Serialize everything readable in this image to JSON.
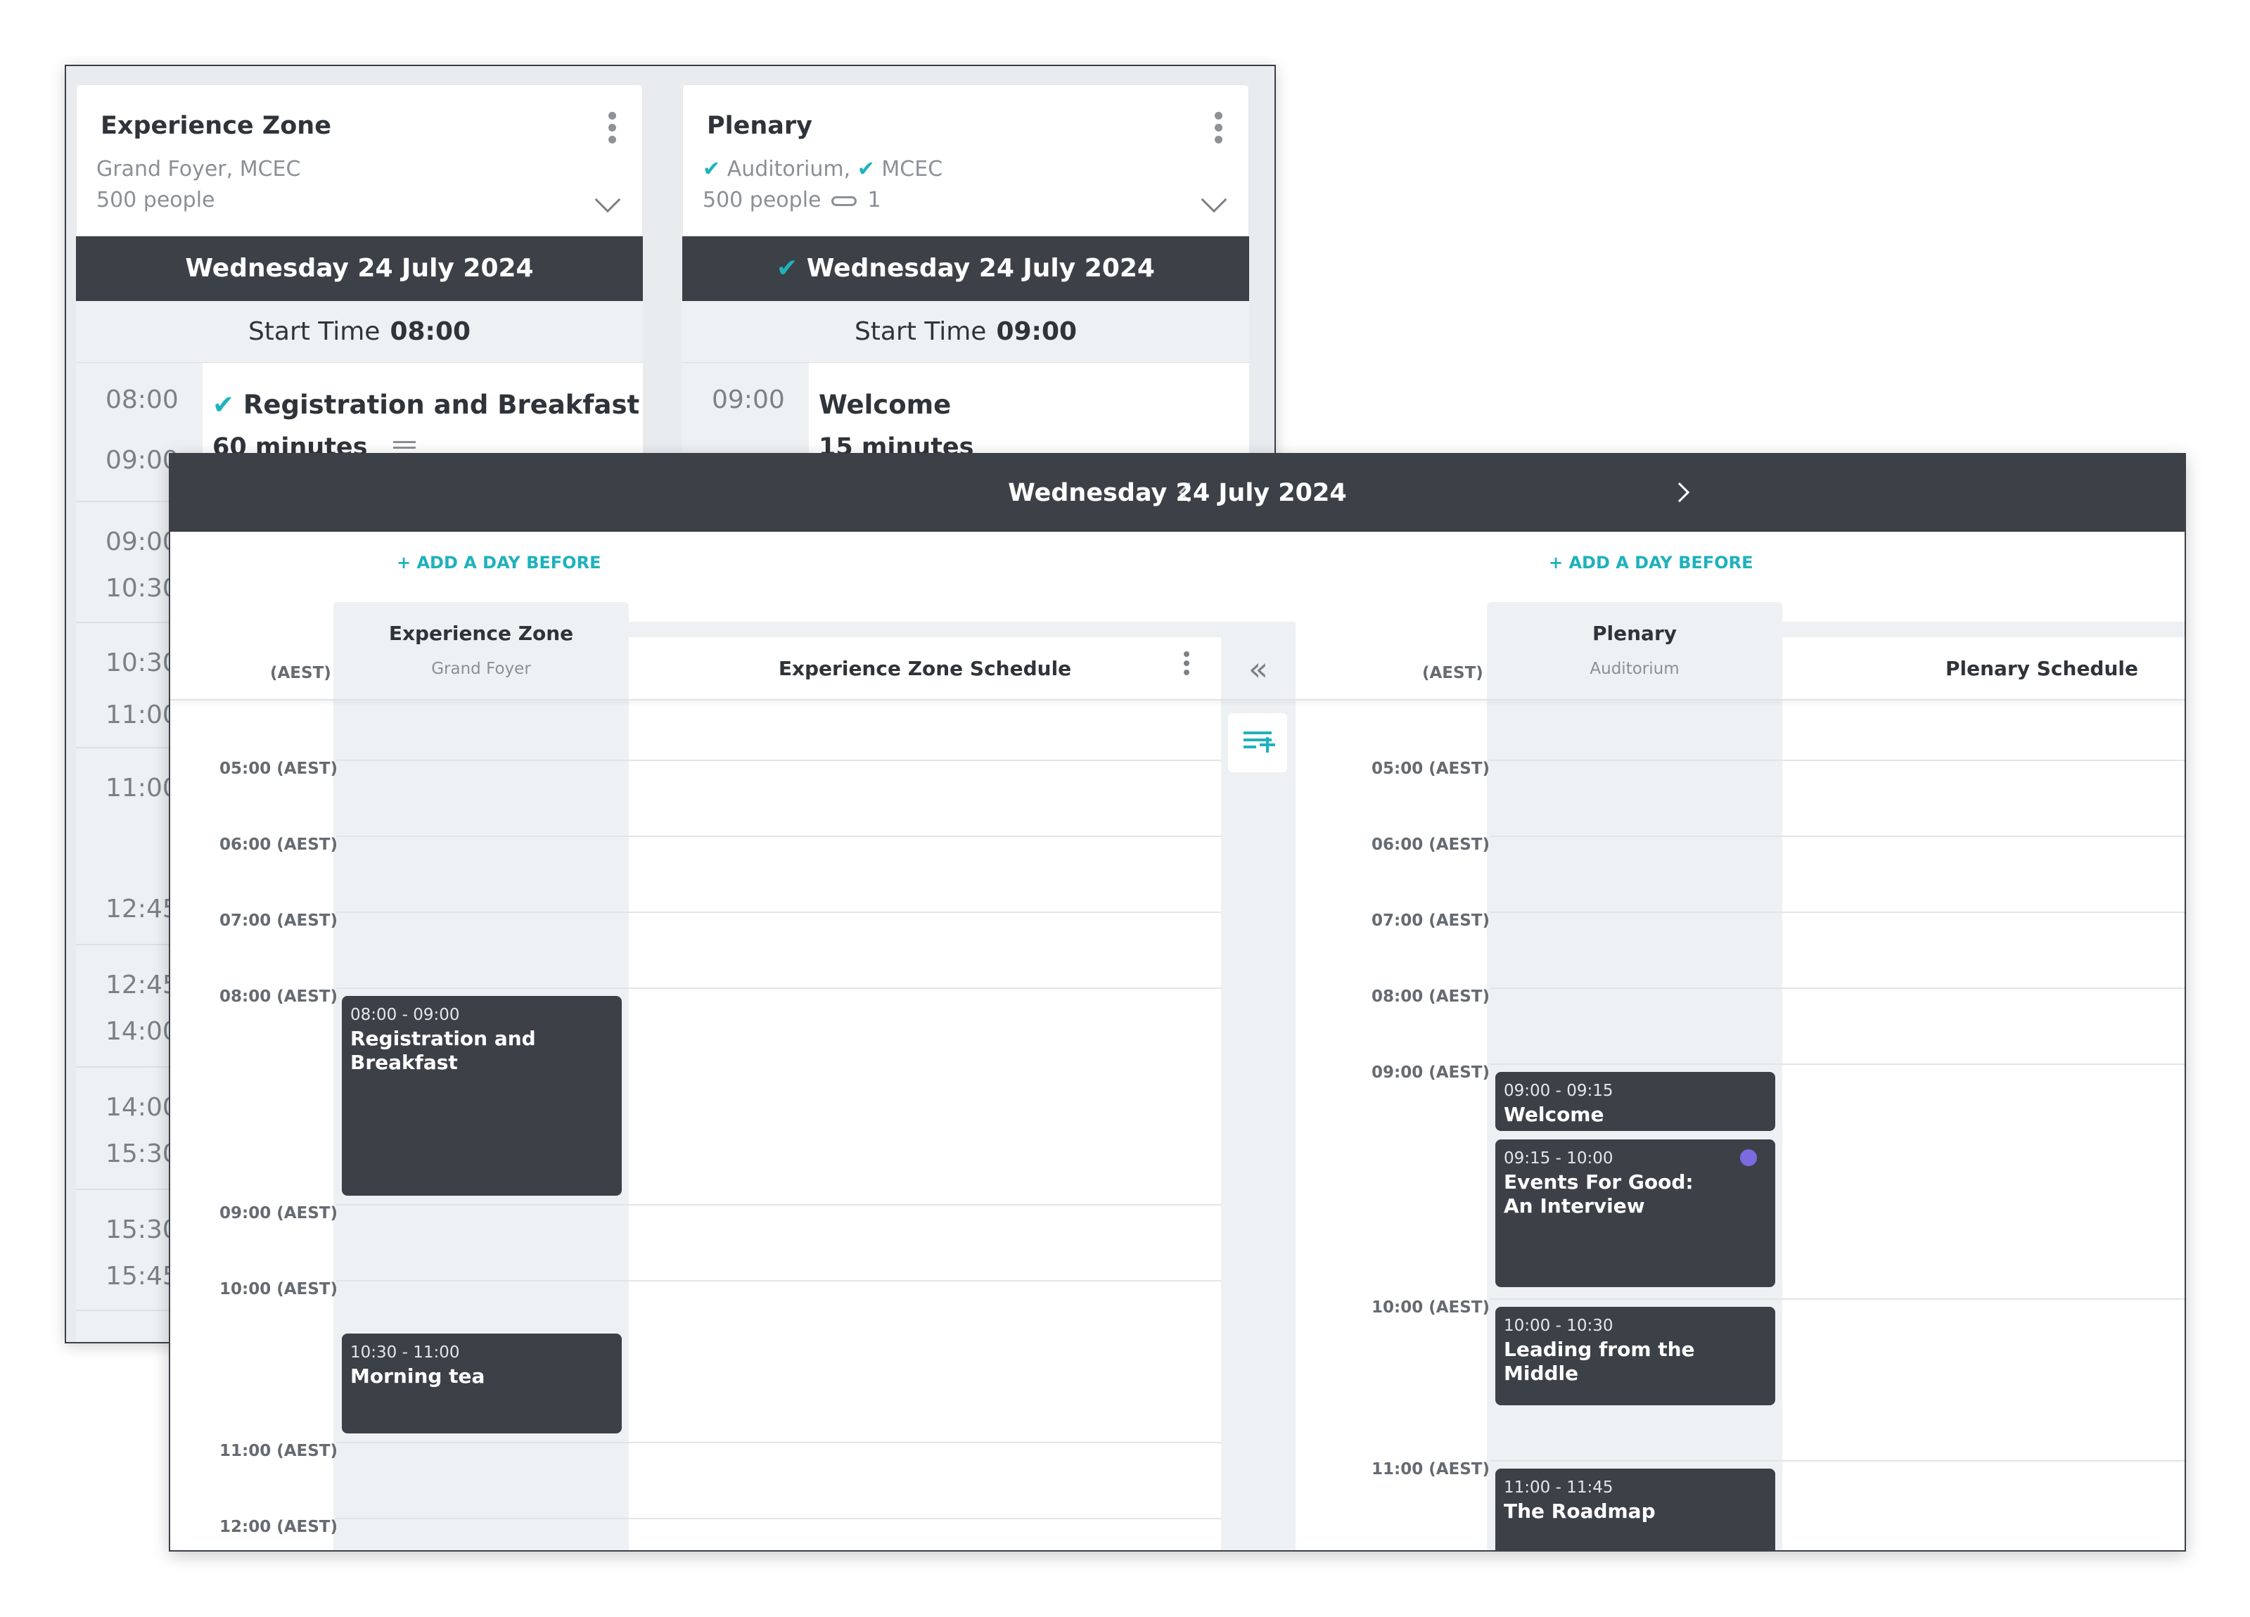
{
  "back_window": {
    "rooms": [
      {
        "title": "Experience Zone",
        "location": "Grand Foyer, MCEC",
        "capacity": "500 people",
        "date": "Wednesday 24 July 2024",
        "start_label": "Start Time",
        "start_time": "08:00",
        "first_item": {
          "time": "08:00",
          "end": "09:00",
          "title": "Registration and Breakfast",
          "duration": "60 minutes"
        },
        "times": [
          "09:00",
          "10:30",
          "10:30",
          "11:00",
          "11:00",
          "12:45",
          "12:45",
          "14:00",
          "14:00",
          "15:30",
          "15:30",
          "15:45"
        ]
      },
      {
        "title": "Plenary",
        "location_part1": "Auditorium,",
        "location_part2": "MCEC",
        "capacity": "500 people",
        "attachments": "1",
        "date": "Wednesday 24 July 2024",
        "start_label": "Start Time",
        "start_time": "09:00",
        "first_item": {
          "time": "09:00",
          "title": "Welcome",
          "duration": "15 minutes"
        }
      }
    ]
  },
  "front_window": {
    "date": "Wednesday 24 July 2024",
    "add_day_before": "+ ADD A DAY BEFORE",
    "tz_label": "(AEST)",
    "left": {
      "room": "Experience Zone",
      "location": "Grand Foyer",
      "schedule_title": "Experience Zone Schedule",
      "hours": [
        "05:00 (AEST)",
        "06:00 (AEST)",
        "07:00 (AEST)",
        "08:00 (AEST)",
        "09:00 (AEST)",
        "10:00 (AEST)",
        "11:00 (AEST)",
        "12:00 (AEST)"
      ],
      "events": [
        {
          "time": "08:00 - 09:00",
          "title": "Registration and Breakfast"
        },
        {
          "time": "10:30 - 11:00",
          "title": "Morning tea"
        }
      ]
    },
    "right": {
      "room": "Plenary",
      "location": "Auditorium",
      "schedule_title": "Plenary Schedule",
      "hours": [
        "05:00 (AEST)",
        "06:00 (AEST)",
        "07:00 (AEST)",
        "08:00 (AEST)",
        "09:00 (AEST)",
        "10:00 (AEST)",
        "11:00 (AEST)"
      ],
      "events": [
        {
          "time": "09:00 - 09:15",
          "title": "Welcome"
        },
        {
          "time": "09:15 - 10:00",
          "title": "Events For Good: An Interview"
        },
        {
          "time": "10:00 - 10:30",
          "title": "Leading from the Middle"
        },
        {
          "time": "11:00 - 11:45",
          "title": "The Roadmap"
        }
      ]
    }
  }
}
